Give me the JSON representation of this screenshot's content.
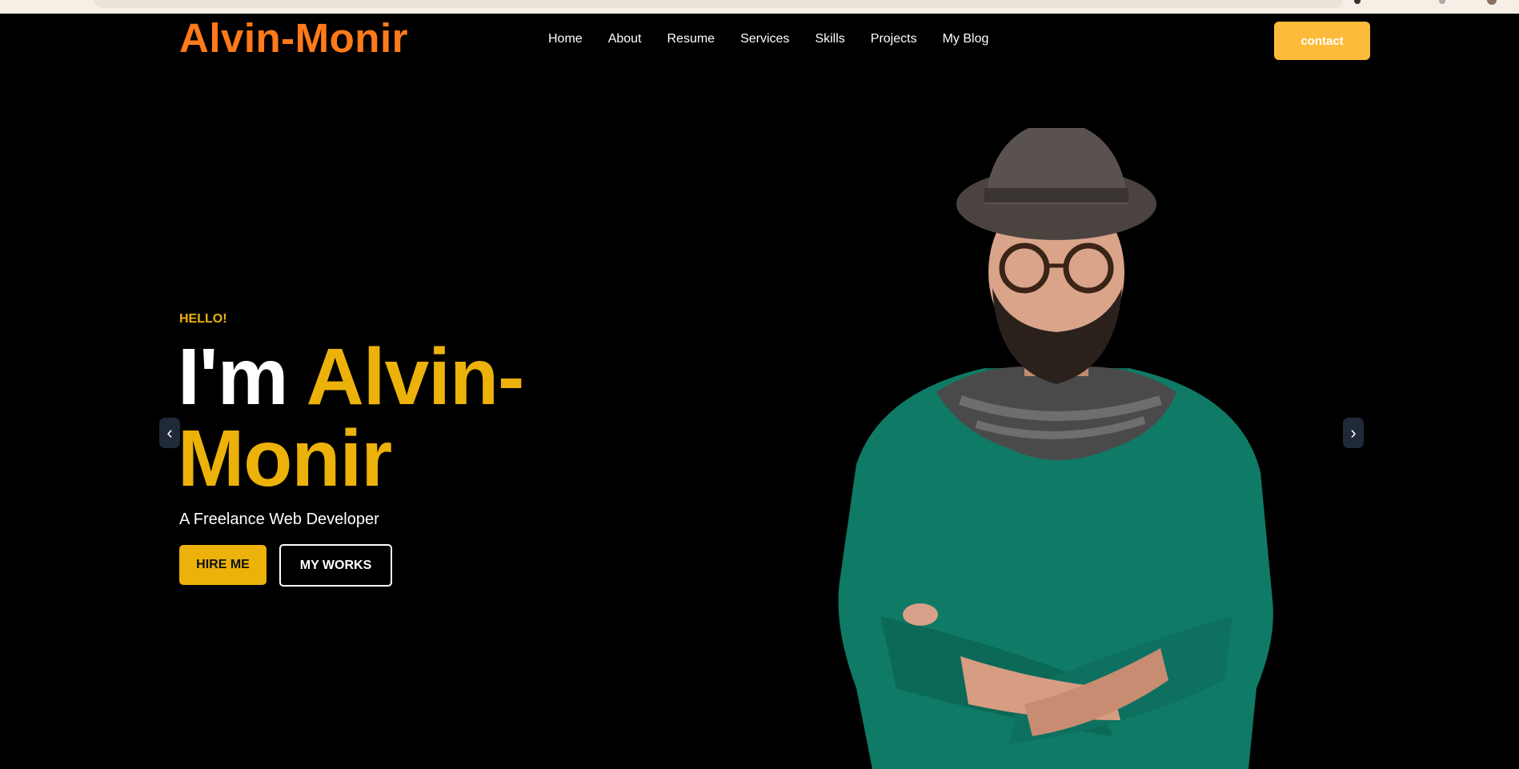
{
  "logo": "Alvin-Monir",
  "nav": {
    "items": [
      "Home",
      "About",
      "Resume",
      "Services",
      "Skills",
      "Projects",
      "My Blog"
    ],
    "contact_label": "contact"
  },
  "hero": {
    "greeting": "HELLO!",
    "headline_prefix": "I'm ",
    "headline_name": "Alvin-Monir",
    "subtitle": "A Freelance Web Developer",
    "hire_label": "HIRE ME",
    "works_label": "MY WORKS",
    "prev_icon": "‹",
    "next_icon": "›"
  },
  "colors": {
    "background": "#000000",
    "logo": "#ff7a1a",
    "accent": "#ecb20a",
    "contact_button": "#fcbc3a",
    "sweater": "#0f7a66"
  }
}
